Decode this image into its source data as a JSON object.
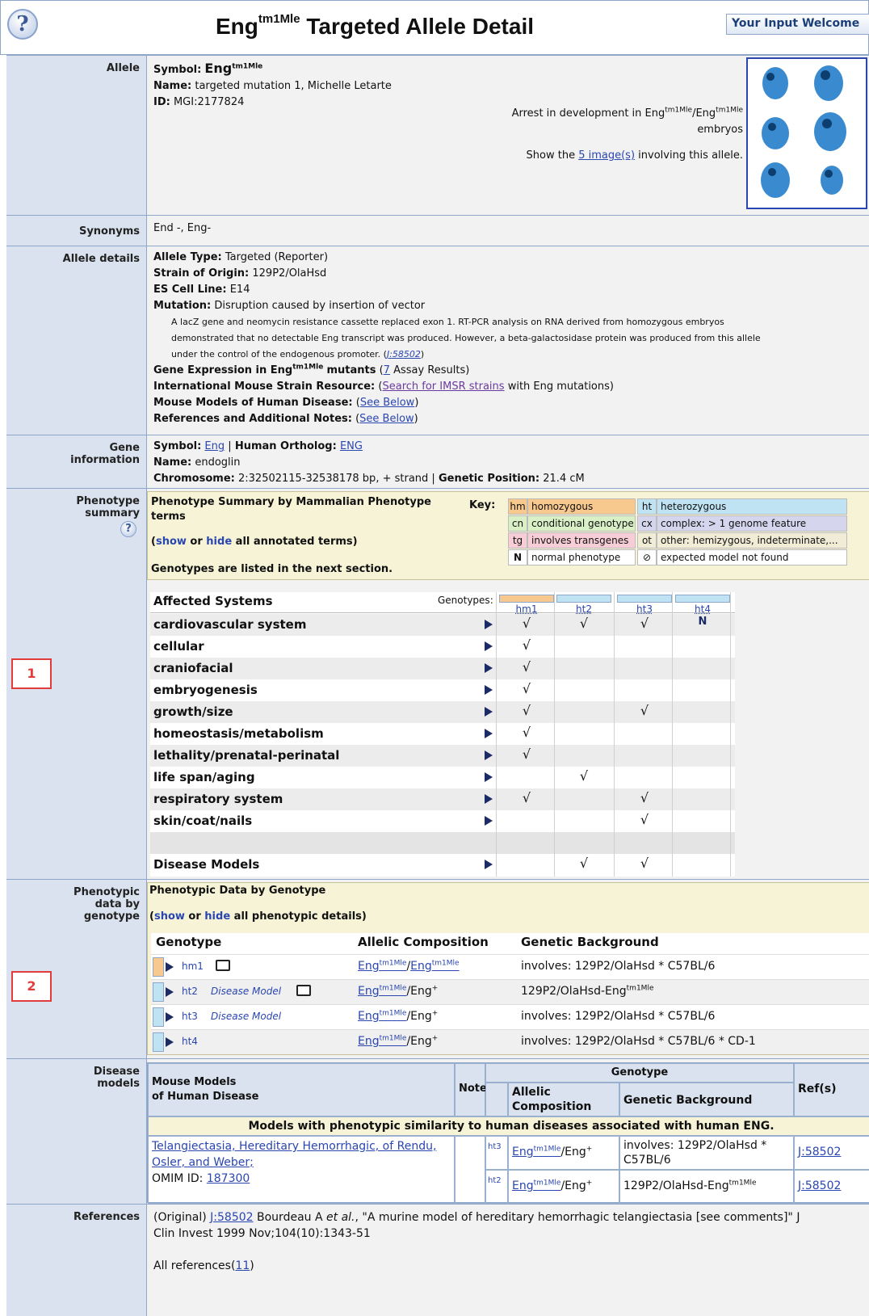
{
  "header": {
    "help_icon": "question-mark-icon",
    "title_base": "Eng",
    "title_sup": "tm1Mle",
    "title_rest": " Targeted Allele Detail",
    "input_button": "Your Input Welcome"
  },
  "allele": {
    "label": "Allele",
    "symbol_label": "Symbol:",
    "symbol_base": "Eng",
    "symbol_sup": "tm1Mle",
    "name_label": "Name:",
    "name": "targeted mutation 1, Michelle Letarte",
    "id_label": "ID:",
    "id": "MGI:2177824",
    "caption_pre": "Arrest in development in Eng",
    "caption_sup1": "tm1Mle",
    "caption_mid": "/Eng",
    "caption_sup2": "tm1Mle",
    "caption_end": "embryos",
    "show_pre": "Show the",
    "show_link": "5 image(s)",
    "show_post": "involving this allele."
  },
  "synonyms": {
    "label": "Synonyms",
    "value": "End -, Eng-"
  },
  "details": {
    "label": "Allele details",
    "type_label": "Allele Type:",
    "type": "Targeted (Reporter)",
    "strain_label": "Strain of Origin:",
    "strain": "129P2/OlaHsd",
    "es_label": "ES Cell Line:",
    "es": "E14",
    "mutation_label": "Mutation:",
    "mutation": "Disruption caused by insertion of vector",
    "note1": "A lacZ gene and neomycin resistance cassette replaced exon 1. RT-PCR analysis on RNA derived from homozygous embryos",
    "note2": "demonstrated that no detectable Eng transcript was produced. However, a beta-galactosidase protein was produced from this allele",
    "note3": "under the control of the endogenous promoter. (",
    "note_ref": "J:58502",
    "note_close": ")",
    "ge_label_pre": "Gene Expression in Eng",
    "ge_sup": "tm1Mle",
    "ge_label_post": "mutants",
    "ge_open": "(",
    "ge_link": "7",
    "ge_rest": "Assay Results)",
    "imsr_label": "International Mouse Strain Resource:",
    "imsr_open": "(",
    "imsr_link": "Search for IMSR strains",
    "imsr_rest": "with Eng mutations)",
    "mm_label": "Mouse Models of Human Disease:",
    "mm_open": "(",
    "mm_link": "See Below",
    "mm_close": ")",
    "ref_label": "References and Additional Notes:",
    "ref_open": "(",
    "ref_link": "See Below",
    "ref_close": ")"
  },
  "gene": {
    "label1": "Gene",
    "label2": "information",
    "symbol_label": "Symbol:",
    "symbol": "Eng",
    "sep": "|",
    "ortho_label": "Human Ortholog:",
    "ortho": "ENG",
    "name_label": "Name:",
    "name": "endoglin",
    "chr_label": "Chromosome:",
    "chr": "2:32502115-32538178 bp, + strand",
    "sep2": "|",
    "pos_label": "Genetic Position:",
    "pos": "21.4 cM"
  },
  "phenosum": {
    "label1": "Phenotype",
    "label2": "summary",
    "help_icon": "question-mark-icon",
    "title1": "Phenotype Summary by Mammalian Phenotype",
    "title2": "terms",
    "show": "show",
    "or": "or",
    "hide": "hide",
    "rest": "all annotated terms)",
    "open": "(",
    "genolisted": "Genotypes are listed in the next section.",
    "key_label": "Key:",
    "key": [
      {
        "ab": "hm",
        "text": "homozygous",
        "color": "#f7c98e"
      },
      {
        "ab": "ht",
        "text": "heterozygous",
        "color": "#bfe3f3"
      },
      {
        "ab": "cn",
        "text": "conditional genotype",
        "color": "#d9efc6"
      },
      {
        "ab": "cx",
        "text": "complex: > 1 genome feature",
        "color": "#d6d5ee"
      },
      {
        "ab": "tg",
        "text": "involves transgenes",
        "color": "#f7cdd8"
      },
      {
        "ab": "ot",
        "text": "other: hemizygous, indeterminate,...",
        "color": "#f0ecd6"
      },
      {
        "ab": "N",
        "text": "normal phenotype",
        "color": "#ffffff"
      },
      {
        "ab": "⊘",
        "text": "expected model not found",
        "color": "#ffffff"
      }
    ],
    "affected_label": "Affected Systems",
    "genotypes_label": "Genotypes:",
    "genotypes": [
      {
        "name": "hm1",
        "color": "#f7c98e"
      },
      {
        "name": "ht2",
        "color": "#bfe3f3"
      },
      {
        "name": "ht3",
        "color": "#bfe3f3"
      },
      {
        "name": "ht4",
        "color": "#bfe3f3"
      }
    ],
    "systems": [
      {
        "name": "cardiovascular system",
        "marks": [
          "√",
          "√",
          "√",
          "N"
        ]
      },
      {
        "name": "cellular",
        "marks": [
          "√",
          "",
          "",
          ""
        ]
      },
      {
        "name": "craniofacial",
        "marks": [
          "√",
          "",
          "",
          ""
        ]
      },
      {
        "name": "embryogenesis",
        "marks": [
          "√",
          "",
          "",
          ""
        ]
      },
      {
        "name": "growth/size",
        "marks": [
          "√",
          "",
          "√",
          ""
        ]
      },
      {
        "name": "homeostasis/metabolism",
        "marks": [
          "√",
          "",
          "",
          ""
        ]
      },
      {
        "name": "lethality/prenatal-perinatal",
        "marks": [
          "√",
          "",
          "",
          ""
        ]
      },
      {
        "name": "life span/aging",
        "marks": [
          "",
          "√",
          "",
          ""
        ]
      },
      {
        "name": "respiratory system",
        "marks": [
          "√",
          "",
          "√",
          ""
        ]
      },
      {
        "name": "skin/coat/nails",
        "marks": [
          "",
          "",
          "√",
          ""
        ]
      }
    ],
    "disease_label": "Disease Models",
    "disease_marks": [
      "",
      "√",
      "√",
      ""
    ]
  },
  "phenodata": {
    "label1": "Phenotypic",
    "label2": "data by",
    "label3": "genotype",
    "title": "Phenotypic Data by Genotype",
    "open": "(",
    "show": "show",
    "or": "or",
    "hide": "hide",
    "rest": "all phenotypic details)",
    "h_geno": "Genotype",
    "h_allelic": "Allelic Composition",
    "h_bg": "Genetic Background",
    "rows": [
      {
        "geno": "hm1",
        "color": "#f7c98e",
        "dm": "",
        "camera": true,
        "a1": "Eng",
        "s1": "tm1Mle",
        "mid": "/",
        "a2": "Eng",
        "s2": "tm1Mle",
        "a2link": true,
        "bg": "involves: 129P2/OlaHsd * C57BL/6",
        "bgsup": ""
      },
      {
        "geno": "ht2",
        "color": "#bfe3f3",
        "dm": "Disease Model",
        "camera": true,
        "a1": "Eng",
        "s1": "tm1Mle",
        "mid": "/Eng",
        "a2": "",
        "s2": "+",
        "a2link": false,
        "bg": "129P2/OlaHsd-Eng",
        "bgsup": "tm1Mle"
      },
      {
        "geno": "ht3",
        "color": "#bfe3f3",
        "dm": "Disease Model",
        "camera": false,
        "a1": "Eng",
        "s1": "tm1Mle",
        "mid": "/Eng",
        "a2": "",
        "s2": "+",
        "a2link": false,
        "bg": "involves: 129P2/OlaHsd * C57BL/6",
        "bgsup": ""
      },
      {
        "geno": "ht4",
        "color": "#bfe3f3",
        "dm": "",
        "camera": false,
        "a1": "Eng",
        "s1": "tm1Mle",
        "mid": "/Eng",
        "a2": "",
        "s2": "+",
        "a2link": false,
        "bg": "involves: 129P2/OlaHsd * C57BL/6 * CD-1",
        "bgsup": ""
      }
    ]
  },
  "disease": {
    "label1": "Disease",
    "label2": "models",
    "h_mm1": "Mouse Models",
    "h_mm2": "of Human Disease",
    "h_note": "Note",
    "h_genotype": "Genotype",
    "h_allelic1": "Allelic",
    "h_allelic2": "Composition",
    "h_bg": "Genetic Background",
    "h_refs": "Ref(s)",
    "banner": "Models with phenotypic similarity to human diseases associated with human ENG.",
    "disease_link1": "Telangiectasia, Hereditary Hemorrhagic, of Rendu,",
    "disease_link2": "Osler, and Weber;",
    "omim_label": "OMIM ID:",
    "omim": "187300",
    "rows": [
      {
        "geno": "ht3",
        "a": "Eng",
        "s": "tm1Mle",
        "rest": "/Eng",
        "plus": "+",
        "bg1": "involves: 129P2/OlaHsd *",
        "bg2": "C57BL/6",
        "bgsup": "",
        "ref": "J:58502"
      },
      {
        "geno": "ht2",
        "a": "Eng",
        "s": "tm1Mle",
        "rest": "/Eng",
        "plus": "+",
        "bg1": "129P2/OlaHsd-Eng",
        "bg2": "",
        "bgsup": "tm1Mle",
        "ref": "J:58502"
      }
    ]
  },
  "references": {
    "label": "References",
    "orig": "(Original)",
    "ref": "J:58502",
    "author": "Bourdeau A",
    "etal": "et al.",
    "cite1": ", \"A murine model of hereditary hemorrhagic telangiectasia [see comments]\" J",
    "cite2": "Clin Invest 1999 Nov;104(10):1343-51",
    "all_label": "All references(",
    "all_link": "11",
    "all_close": ")"
  },
  "markers": {
    "one": "1",
    "two": "2"
  }
}
